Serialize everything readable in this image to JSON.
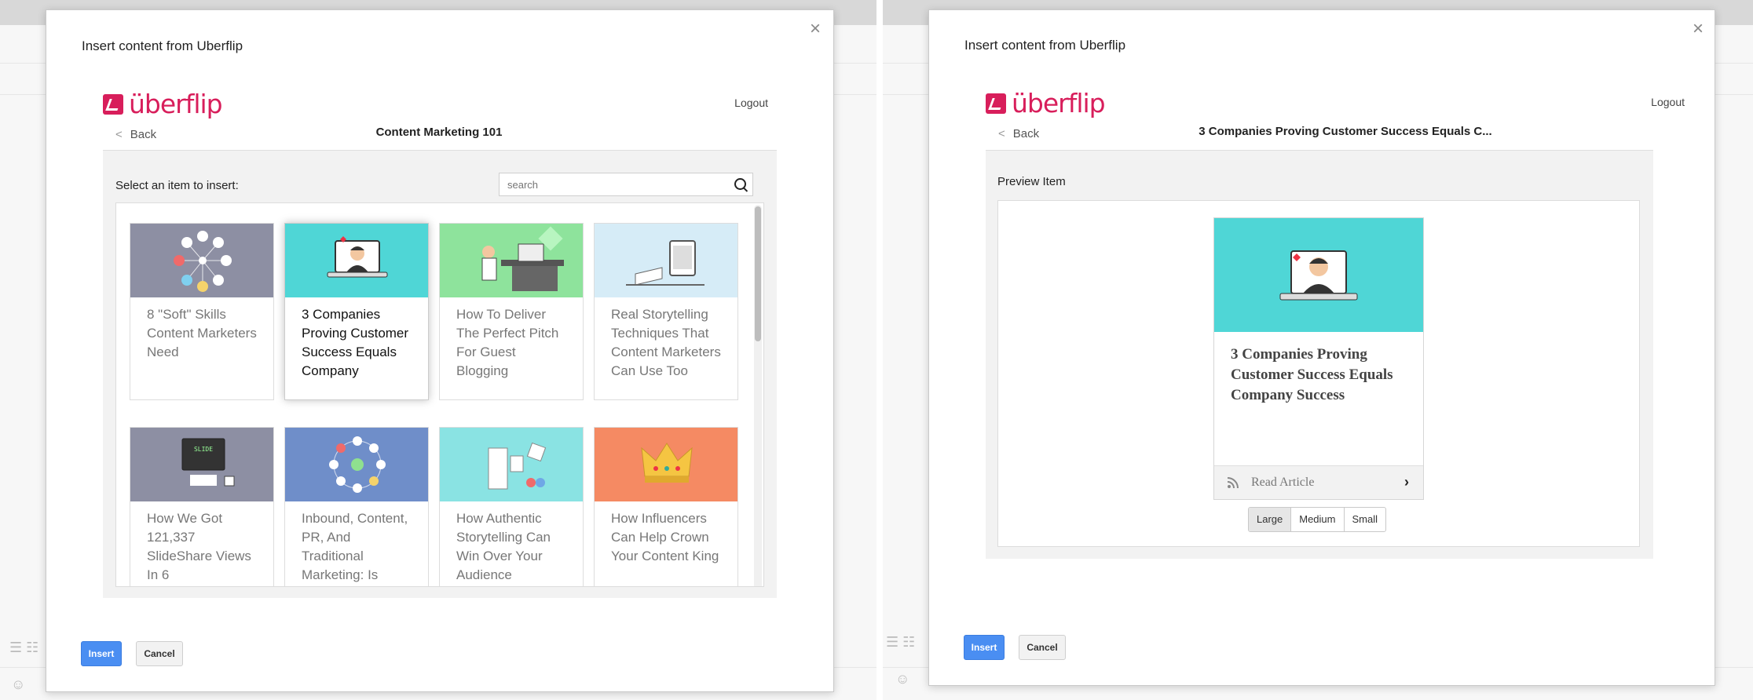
{
  "colors": {
    "brand": "#d81e5b",
    "primary_button": "#4a8ef2",
    "teal": "#4fd6d6"
  },
  "left": {
    "modal_title": "Insert content from Uberflip",
    "brand_name": "überflip",
    "logout": "Logout",
    "back": "Back",
    "collection_title": "Content Marketing 101",
    "select_label": "Select an item to insert:",
    "search_placeholder": "search",
    "cards": [
      {
        "title": "8 \"Soft\" Skills Content Marketers Need"
      },
      {
        "title": "3 Companies Proving Customer Success Equals Company"
      },
      {
        "title": "How To Deliver The Perfect Pitch For Guest Blogging"
      },
      {
        "title": "Real Storytelling Techniques That Content Marketers Can Use Too"
      },
      {
        "title": "How We Got 121,337 SlideShare Views In 6"
      },
      {
        "title": "Inbound, Content, PR, And Traditional Marketing: Is"
      },
      {
        "title": "How Authentic Storytelling Can Win Over Your Audience"
      },
      {
        "title": "How Influencers Can Help Crown Your Content King"
      }
    ],
    "insert_label": "Insert",
    "cancel_label": "Cancel"
  },
  "right": {
    "modal_title": "Insert content from Uberflip",
    "brand_name": "überflip",
    "logout": "Logout",
    "back": "Back",
    "item_title": "3 Companies Proving Customer Success Equals C...",
    "preview_label": "Preview Item",
    "preview_card_title": "3 Companies Proving Customer Success Equals Company Success",
    "read_article": "Read Article",
    "sizes": [
      "Large",
      "Medium",
      "Small"
    ],
    "selected_size": "Large",
    "insert_label": "Insert",
    "cancel_label": "Cancel"
  },
  "icons": [
    "close-icon",
    "back-chevron-icon",
    "search-icon",
    "rss-icon",
    "chevron-right-icon",
    "emoji-icon",
    "list-icon"
  ]
}
